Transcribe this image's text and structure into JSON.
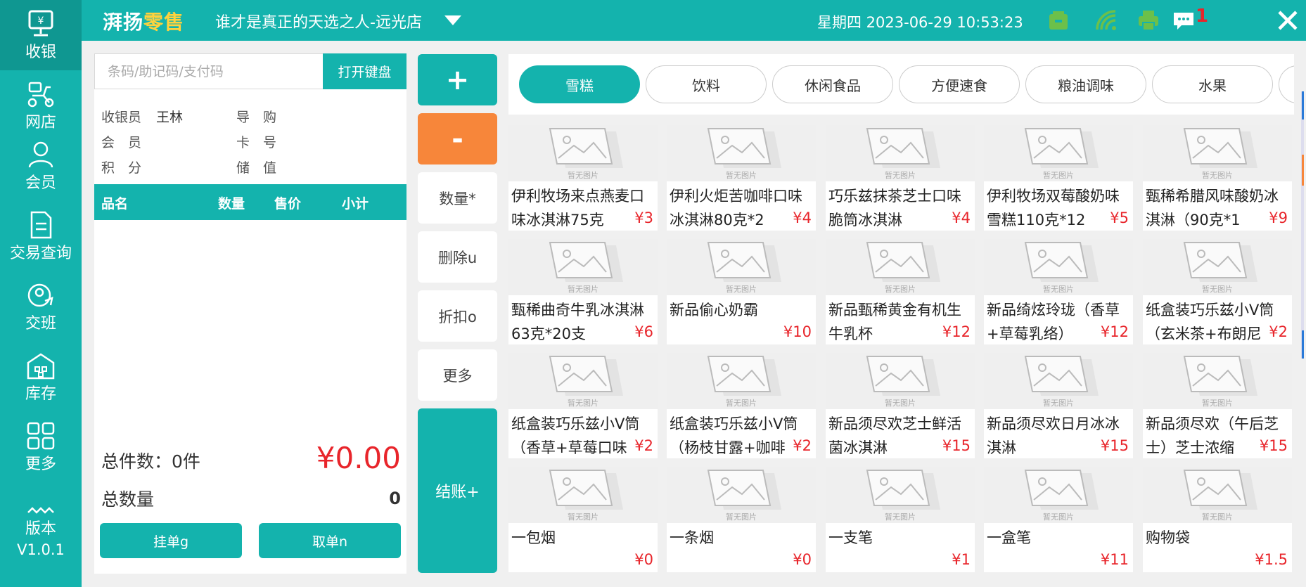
{
  "nav": {
    "items": [
      {
        "label": "收银",
        "icon": "cash-register-icon"
      },
      {
        "label": "网店",
        "icon": "scooter-icon"
      },
      {
        "label": "会员",
        "icon": "user-icon"
      },
      {
        "label": "交易查询",
        "icon": "document-icon"
      },
      {
        "label": "交班",
        "icon": "shift-handover-icon"
      },
      {
        "label": "库存",
        "icon": "warehouse-icon"
      },
      {
        "label": "更多",
        "icon": "grid-icon"
      }
    ],
    "version_label": "版本",
    "version_value": "V1.0.1"
  },
  "header": {
    "brand_part1": "湃扬",
    "brand_part2": "零售",
    "store_name": "谁才是真正的天选之人-远光店",
    "datetime": "星期四 2023-06-29 10:53:23",
    "message_count": "1"
  },
  "left": {
    "search_placeholder": "条码/助记码/支付码",
    "keyboard_label": "打开键盘",
    "info": {
      "cashier_label": "收银员",
      "cashier_value": "王林",
      "guide_label": "导　购",
      "member_label": "会　员",
      "card_label": "卡　号",
      "points_label": "积　分",
      "stored_label": "储　值"
    },
    "columns": [
      "品名",
      "数量",
      "售价",
      "小计"
    ],
    "total_count_label": "总件数：0件",
    "total_amount": "¥0.00",
    "total_qty_label": "总数量",
    "total_qty_value": "0",
    "hold_label": "挂单g",
    "retrieve_label": "取单n"
  },
  "actions": {
    "plus": "+",
    "minus": "-",
    "quantity": "数量*",
    "delete": "删除u",
    "discount": "折扣o",
    "more": "更多",
    "checkout": "结账+"
  },
  "categories": [
    "雪糕",
    "饮料",
    "休闲食品",
    "方便速食",
    "粮油调味",
    "水果"
  ],
  "placeholder_text": "暂无图片",
  "products": [
    {
      "name": "伊利牧场来点燕麦口味冰淇淋75克",
      "price": "¥3"
    },
    {
      "name": "伊利火炬苦咖啡口味冰淇淋80克*2",
      "price": "¥4"
    },
    {
      "name": "巧乐兹抹茶芝士口味脆筒冰淇淋",
      "price": "¥4"
    },
    {
      "name": "伊利牧场双莓酸奶味雪糕110克*12",
      "price": "¥5"
    },
    {
      "name": "甄稀希腊风味酸奶冰淇淋（90克*1",
      "price": "¥9"
    },
    {
      "name": "甄稀曲奇牛乳冰淇淋63克*20支",
      "price": "¥6"
    },
    {
      "name": "新品偷心奶霸",
      "price": "¥10"
    },
    {
      "name": "新品甄稀黄金有机生牛乳杯",
      "price": "¥12"
    },
    {
      "name": "新品绮炫玲珑（香草+草莓乳络）",
      "price": "¥12"
    },
    {
      "name": "纸盒装巧乐兹小V筒（玄米茶+布朗尼",
      "price": "¥2"
    },
    {
      "name": "纸盒装巧乐兹小V筒（香草+草莓口味",
      "price": "¥2"
    },
    {
      "name": "纸盒装巧乐兹小V筒（杨枝甘露+咖啡",
      "price": "¥2"
    },
    {
      "name": "新品须尽欢芝士鲜活菌冰淇淋",
      "price": "¥15"
    },
    {
      "name": "新品须尽欢日月冰冰淇淋",
      "price": "¥15"
    },
    {
      "name": "新品须尽欢（午后芝士）芝士浓缩",
      "price": "¥15"
    },
    {
      "name": "一包烟",
      "price": "¥0"
    },
    {
      "name": "一条烟",
      "price": "¥0"
    },
    {
      "name": "一支笔",
      "price": "¥1"
    },
    {
      "name": "一盒笔",
      "price": "¥11"
    },
    {
      "name": "购物袋",
      "price": "¥1.5"
    }
  ]
}
